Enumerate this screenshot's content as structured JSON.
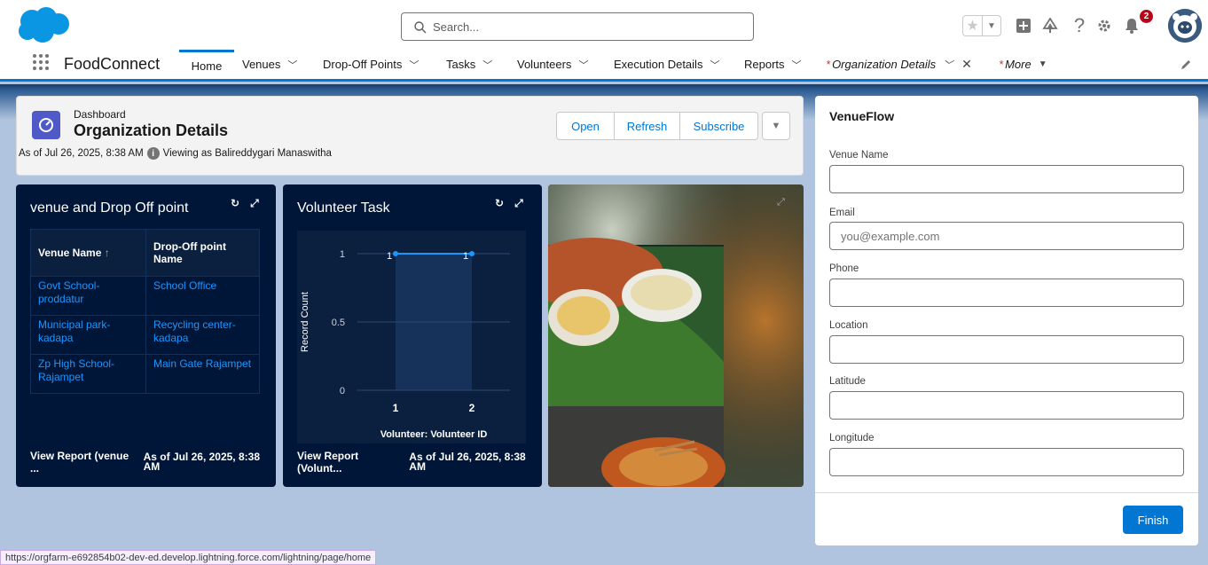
{
  "header": {
    "search_placeholder": "Search...",
    "notification_count": "2",
    "help_glyph": "?"
  },
  "nav": {
    "app_name": "FoodConnect",
    "items": [
      {
        "label": "Home"
      },
      {
        "label": "Venues"
      },
      {
        "label": "Drop-Off Points"
      },
      {
        "label": "Tasks"
      },
      {
        "label": "Volunteers"
      },
      {
        "label": "Execution Details"
      },
      {
        "label": "Reports"
      },
      {
        "label": "Organization Details"
      },
      {
        "label": "More"
      }
    ],
    "modified_marker": "*"
  },
  "dashboard": {
    "label": "Dashboard",
    "title": "Organization Details",
    "as_of": "As of Jul 26, 2025, 8:38 AM",
    "viewing_as": "Viewing as Balireddygari Manaswitha",
    "buttons": {
      "open": "Open",
      "refresh": "Refresh",
      "subscribe": "Subscribe"
    }
  },
  "venue_widget": {
    "title": "venue and Drop Off point",
    "columns": [
      "Venue Name",
      "Drop-Off point Name"
    ],
    "sort_indicator": "↑",
    "rows": [
      {
        "venue": "Govt School-proddatur",
        "dropoff": "School Office"
      },
      {
        "venue": "Municipal park-kadapa",
        "dropoff": "Recycling center-kadapa"
      },
      {
        "venue": "Zp High School-Rajampet",
        "dropoff": "Main Gate Rajampet"
      }
    ],
    "footer_link": "View Report (venue ...",
    "footer_time": "As of Jul 26, 2025, 8:38 AM"
  },
  "volunteer_widget": {
    "title": "Volunteer Task",
    "footer_link": "View Report (Volunt...",
    "footer_time": "As of Jul 26, 2025, 8:38 AM"
  },
  "chart_data": {
    "type": "line",
    "x": [
      "1",
      "2"
    ],
    "series": [
      {
        "values": [
          1,
          1
        ]
      }
    ],
    "data_labels": [
      "1",
      "1"
    ],
    "y_ticks": [
      "0",
      "0.5",
      "1"
    ],
    "xlabel": "Volunteer: Volunteer ID",
    "ylabel": "Record Count",
    "ylim": [
      0,
      1
    ],
    "grid": true
  },
  "flow": {
    "title": "VenueFlow",
    "fields": [
      {
        "label": "Venue Name",
        "placeholder": "",
        "value": ""
      },
      {
        "label": "Email",
        "placeholder": "you@example.com",
        "value": ""
      },
      {
        "label": "Phone",
        "placeholder": "",
        "value": ""
      },
      {
        "label": "Location",
        "placeholder": "",
        "value": ""
      },
      {
        "label": "Latitude",
        "placeholder": "",
        "value": ""
      },
      {
        "label": "Longitude",
        "placeholder": "",
        "value": ""
      }
    ],
    "finish_label": "Finish"
  },
  "statusbar": {
    "url": "https://orgfarm-e692854b02-dev-ed.develop.lightning.force.com/lightning/page/home"
  },
  "colors": {
    "brand_blue": "#0176d3",
    "widget_bg": "#001639",
    "link_blue": "#1b96ff",
    "dashboard_icon": "#4f59c7"
  }
}
